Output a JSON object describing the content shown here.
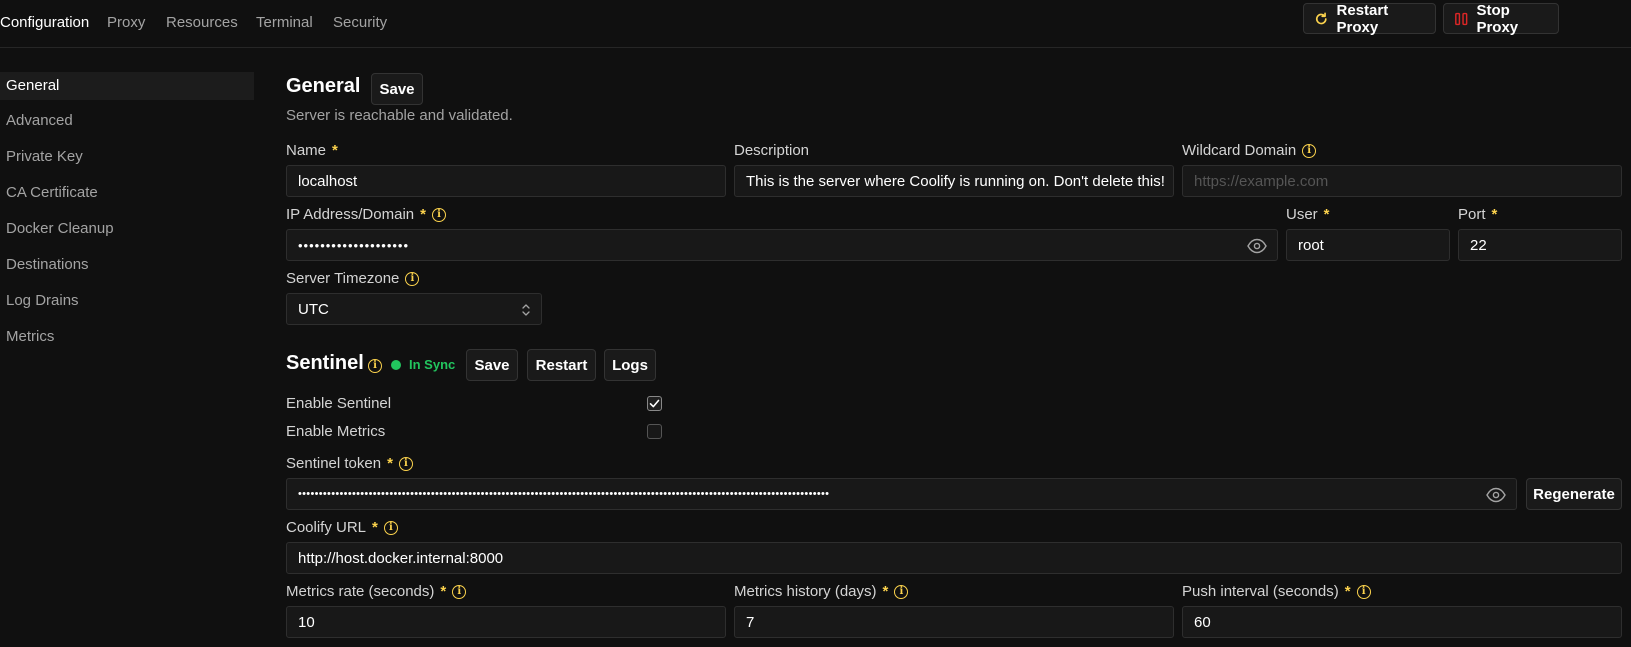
{
  "topnav": {
    "tabs": [
      "Configuration",
      "Proxy",
      "Resources",
      "Terminal",
      "Security"
    ],
    "restart_proxy": "Restart Proxy",
    "stop_proxy": "Stop Proxy"
  },
  "sidebar": {
    "items": [
      "General",
      "Advanced",
      "Private Key",
      "CA Certificate",
      "Docker Cleanup",
      "Destinations",
      "Log Drains",
      "Metrics"
    ]
  },
  "general": {
    "title": "General",
    "save_label": "Save",
    "status_text": "Server is reachable and validated.",
    "name_label": "Name",
    "name_value": "localhost",
    "description_label": "Description",
    "description_value": "This is the server where Coolify is running on. Don't delete this!",
    "wildcard_label": "Wildcard Domain",
    "wildcard_placeholder": "https://example.com",
    "ip_label": "IP Address/Domain",
    "ip_value": "••••••••••••••••••••",
    "user_label": "User",
    "user_value": "root",
    "port_label": "Port",
    "port_value": "22",
    "timezone_label": "Server Timezone",
    "timezone_value": "UTC",
    "required_mark": "*"
  },
  "sentinel": {
    "title": "Sentinel",
    "status": "In Sync",
    "save_label": "Save",
    "restart_label": "Restart",
    "logs_label": "Logs",
    "enable_sentinel_label": "Enable Sentinel",
    "enable_sentinel_checked": true,
    "enable_metrics_label": "Enable Metrics",
    "enable_metrics_checked": false,
    "token_label": "Sentinel token",
    "token_value": "••••••••••••••••••••••••••••••••••••••••••••••••••••••••••••••••••••••••••••••••••••••••••••••••••••••••••••••••••••••••••••••••",
    "regenerate_label": "Regenerate",
    "url_label": "Coolify URL",
    "url_value": "http://host.docker.internal:8000",
    "rate_label": "Metrics rate (seconds)",
    "rate_value": "10",
    "history_label": "Metrics history (days)",
    "history_value": "7",
    "push_label": "Push interval (seconds)",
    "push_value": "60"
  },
  "colors": {
    "background": "#101010",
    "accent_required": "#fcd34d",
    "status_green": "#22c55e",
    "stop_red": "#dc2626"
  },
  "icons": {
    "info": "info-icon",
    "eye": "eye-icon",
    "restart": "refresh-icon",
    "stop": "stop-icon",
    "check": "check-icon",
    "chevron": "chevron-up-down-icon"
  }
}
